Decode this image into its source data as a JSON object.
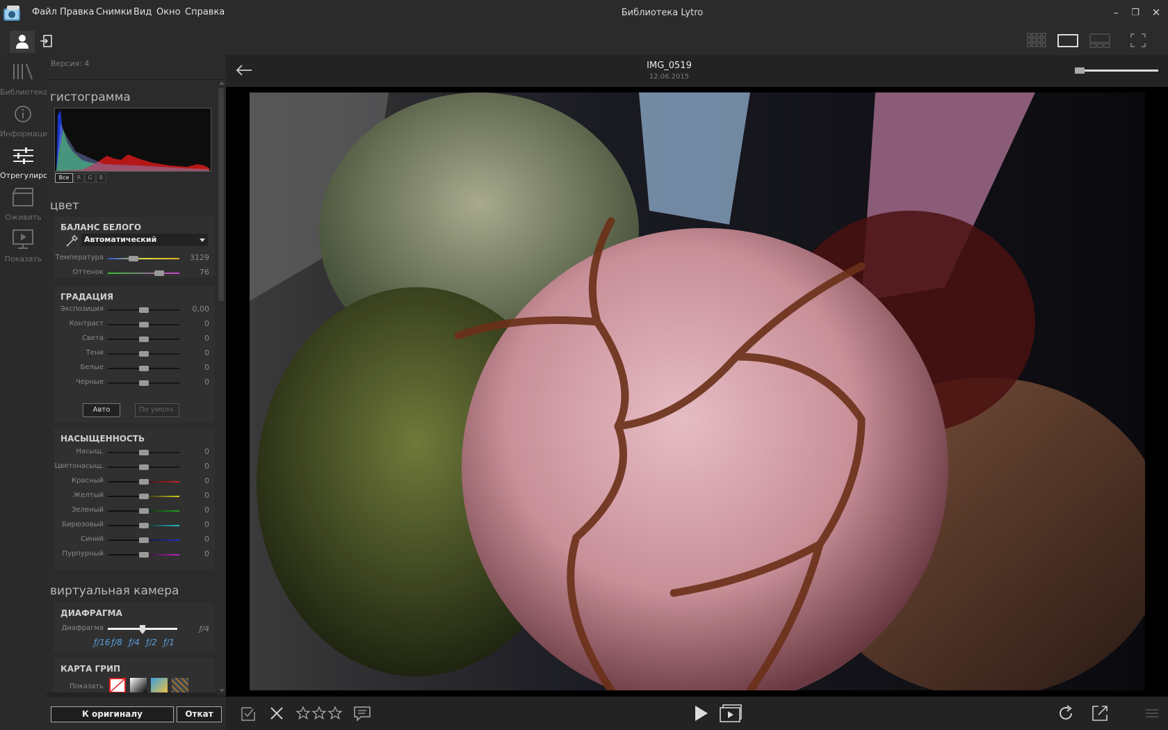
{
  "titlebar": {
    "menu": [
      "Файл",
      "Правка",
      "Снимки",
      "Вид",
      "Окно",
      "Справка"
    ],
    "window_title": "Библиотека Lytro",
    "min": "–",
    "max": "❐",
    "close": "✕"
  },
  "nav": {
    "items": [
      {
        "label": "Библиотека",
        "icon": "library-icon"
      },
      {
        "label": "Информация",
        "icon": "info-icon"
      },
      {
        "label": "Отрегулировать",
        "icon": "adjust-icon"
      },
      {
        "label": "Оживить",
        "icon": "animate-icon"
      },
      {
        "label": "Показать",
        "icon": "present-icon"
      }
    ],
    "active": 2
  },
  "panel": {
    "version": "Версия: 4",
    "histogram_title": "гистограмма",
    "histogram_tabs": [
      "Все",
      "R",
      "G",
      "B"
    ],
    "color_title": "цвет",
    "white_balance": {
      "title": "БАЛАНС БЕЛОГО",
      "preset": "Автоматический",
      "sliders": [
        {
          "label": "Температура",
          "value": "3129",
          "pos": 0.36
        },
        {
          "label": "Оттенок",
          "value": "76",
          "pos": 0.72
        }
      ]
    },
    "gradation": {
      "title": "ГРАДАЦИЯ",
      "sliders": [
        {
          "label": "Экспозиция",
          "value": "0,00",
          "pos": 0.5
        },
        {
          "label": "Контраст",
          "value": "0",
          "pos": 0.5
        },
        {
          "label": "Света",
          "value": "0",
          "pos": 0.5
        },
        {
          "label": "Тени",
          "value": "0",
          "pos": 0.5
        },
        {
          "label": "Белые",
          "value": "0",
          "pos": 0.5
        },
        {
          "label": "Черные",
          "value": "0",
          "pos": 0.5
        }
      ],
      "auto_label": "Авто",
      "default_label": "По умолч."
    },
    "saturation": {
      "title": "НАСЫЩЕННОСТЬ",
      "sliders": [
        {
          "label": "Насыщ.",
          "value": "0",
          "pos": 0.5,
          "color": "#111111"
        },
        {
          "label": "Цветонасыщ.",
          "value": "0",
          "pos": 0.5,
          "color": "#111111"
        },
        {
          "label": "Красный",
          "value": "0",
          "pos": 0.5,
          "color": "#d02020"
        },
        {
          "label": "Желтый",
          "value": "0",
          "pos": 0.5,
          "color": "#d8d020"
        },
        {
          "label": "Зеленый",
          "value": "0",
          "pos": 0.5,
          "color": "#20a020"
        },
        {
          "label": "Бирюзовый",
          "value": "0",
          "pos": 0.5,
          "color": "#20c0c8"
        },
        {
          "label": "Синий",
          "value": "0",
          "pos": 0.5,
          "color": "#2030d0"
        },
        {
          "label": "Пурпурный",
          "value": "0",
          "pos": 0.5,
          "color": "#c020c0"
        }
      ]
    },
    "virtual_camera_title": "виртуальная камера",
    "aperture": {
      "title": "ДИАФРАГМА",
      "label": "Диафрагма",
      "value": "ƒ/4",
      "pos": 0.5,
      "stops": [
        "ƒ/16",
        "ƒ/8",
        "ƒ/4",
        "ƒ/2",
        "ƒ/1"
      ]
    },
    "depth_map": {
      "title": "КАРТА ГРИП",
      "label": "Показать"
    },
    "revert_label": "К оригиналу",
    "undo_label": "Откат"
  },
  "viewer": {
    "image_name": "IMG_0519",
    "image_date": "12.06.2015"
  },
  "colors": {
    "accent": "#ffffff",
    "bg": "#232323",
    "panel": "#2b2b2b"
  }
}
